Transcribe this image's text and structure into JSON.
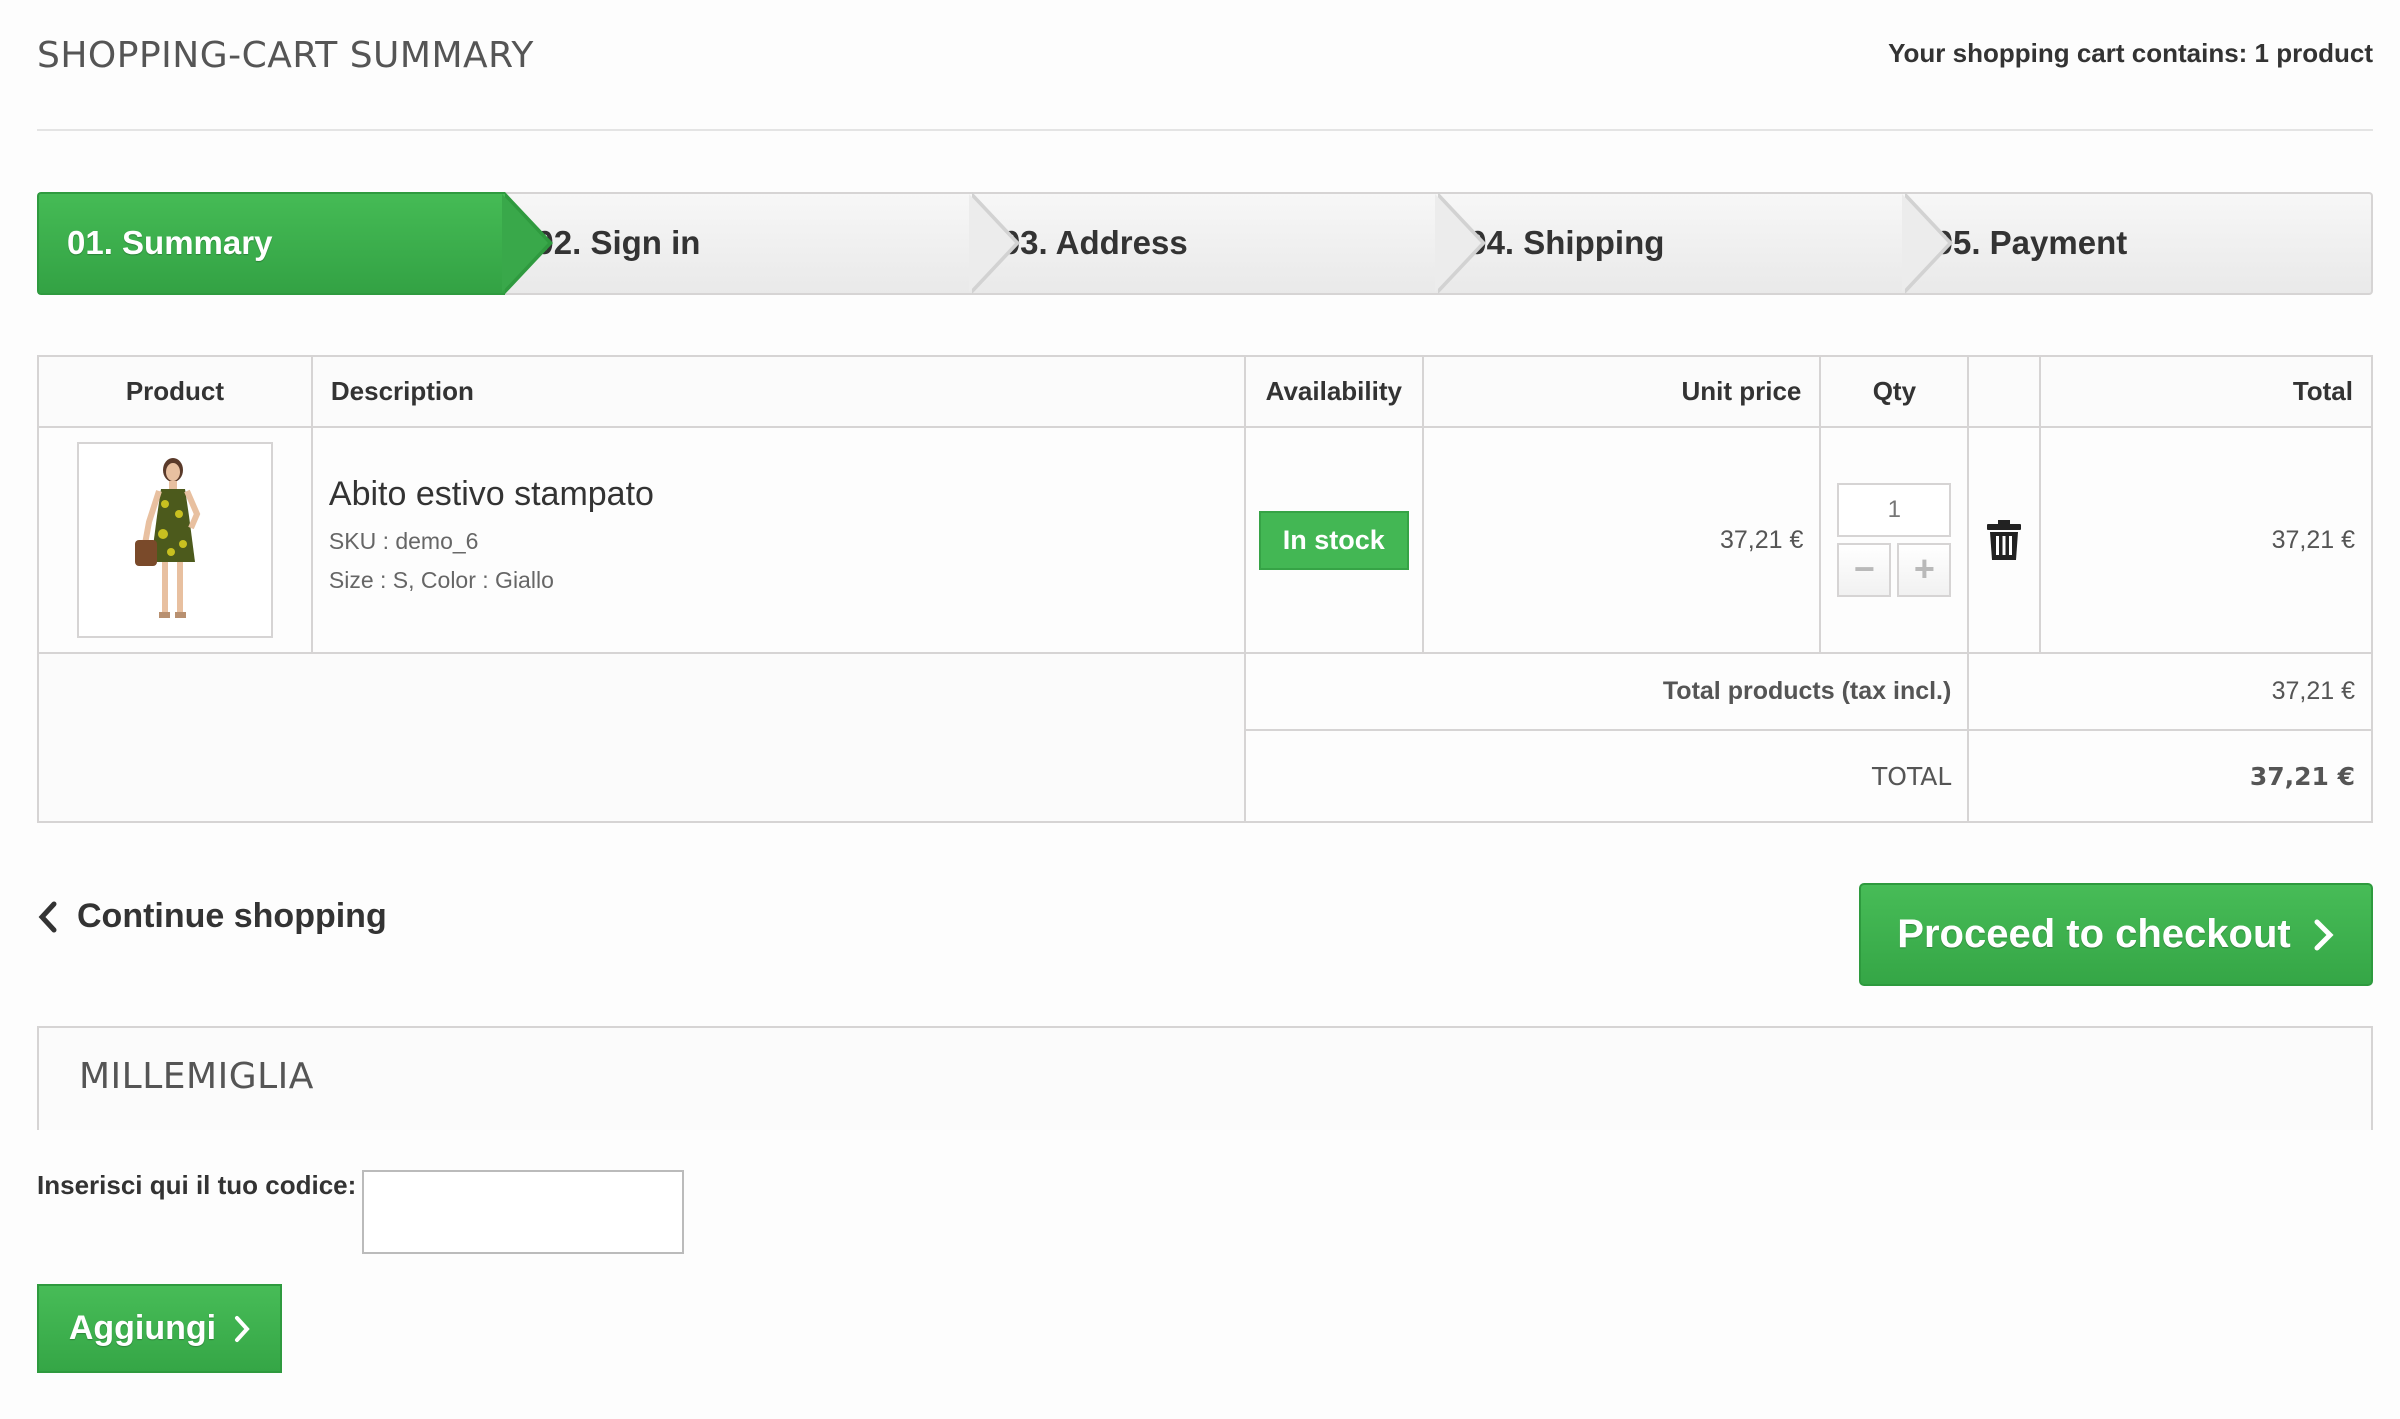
{
  "header": {
    "title": "SHOPPING-CART SUMMARY",
    "cart_count": "Your shopping cart contains: 1 product"
  },
  "steps": [
    {
      "label": "01. Summary",
      "active": true
    },
    {
      "label": "02. Sign in",
      "active": false
    },
    {
      "label": "03. Address",
      "active": false
    },
    {
      "label": "04. Shipping",
      "active": false
    },
    {
      "label": "05. Payment",
      "active": false
    }
  ],
  "table": {
    "headers": {
      "product": "Product",
      "description": "Description",
      "availability": "Availability",
      "unit_price": "Unit price",
      "qty": "Qty",
      "delete": "",
      "total": "Total"
    },
    "rows": [
      {
        "name": "Abito estivo stampato",
        "sku": "SKU : demo_6",
        "attributes": "Size : S, Color : Giallo",
        "availability": "In stock",
        "unit_price": "37,21 €",
        "qty": "1",
        "qty_minus": "−",
        "qty_plus": "+",
        "total": "37,21 €",
        "delete_icon": "trash-icon",
        "image_icon": "dress-photo"
      }
    ],
    "summary": {
      "total_products_label": "Total products (tax incl.)",
      "total_products_value": "37,21 €",
      "total_label": "TOTAL",
      "total_value": "37,21 €"
    }
  },
  "navigation": {
    "continue_label": "Continue shopping",
    "checkout_label": "Proceed to checkout"
  },
  "voucher": {
    "title": "MILLEMIGLIA",
    "code_label": "Inserisci qui il tuo codice:",
    "code_value": "",
    "add_label": "Aggiungi"
  },
  "colors": {
    "accent_green": "#3aab4a",
    "border": "#d6d4d4",
    "text": "#333333"
  }
}
